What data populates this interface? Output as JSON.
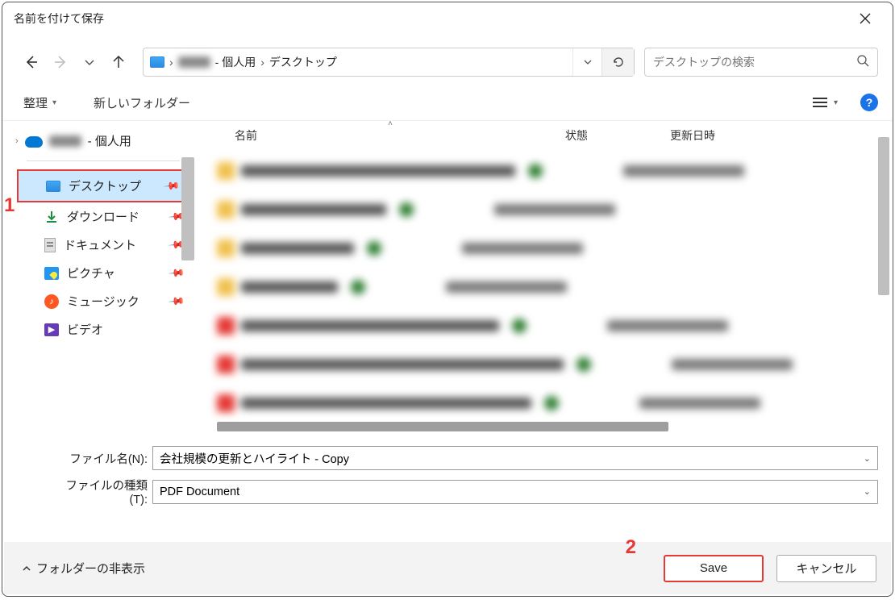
{
  "title": "名前を付けて保存",
  "breadcrumb": {
    "seg1": " - 個人用",
    "seg2": "デスクトップ"
  },
  "search": {
    "placeholder": "デスクトップの検索"
  },
  "toolbar": {
    "organize": "整理",
    "new_folder": "新しいフォルダー"
  },
  "tree": {
    "root": " - 個人用",
    "items": [
      {
        "label": "デスクトップ"
      },
      {
        "label": "ダウンロード"
      },
      {
        "label": "ドキュメント"
      },
      {
        "label": "ピクチャ"
      },
      {
        "label": "ミュージック"
      },
      {
        "label": "ビデオ"
      }
    ]
  },
  "columns": {
    "name": "名前",
    "status": "状態",
    "date": "更新日時"
  },
  "form": {
    "name_label": "ファイル名(N):",
    "name_value": "会社規模の更新とハイライト - Copy",
    "type_label": "ファイルの種類(T):",
    "type_value": "PDF Document"
  },
  "footer": {
    "hide_folders": "フォルダーの非表示",
    "save": "Save",
    "cancel": "キャンセル"
  },
  "annotations": {
    "n1": "1",
    "n2": "2"
  },
  "list_rows": [
    {
      "ico": "#f2c14e",
      "namew": 340
    },
    {
      "ico": "#f2c14e",
      "namew": 180
    },
    {
      "ico": "#f2c14e",
      "namew": 140
    },
    {
      "ico": "#f2c14e",
      "namew": 120
    },
    {
      "ico": "#e53935",
      "namew": 320
    },
    {
      "ico": "#e53935",
      "namew": 400
    },
    {
      "ico": "#e53935",
      "namew": 360
    }
  ]
}
